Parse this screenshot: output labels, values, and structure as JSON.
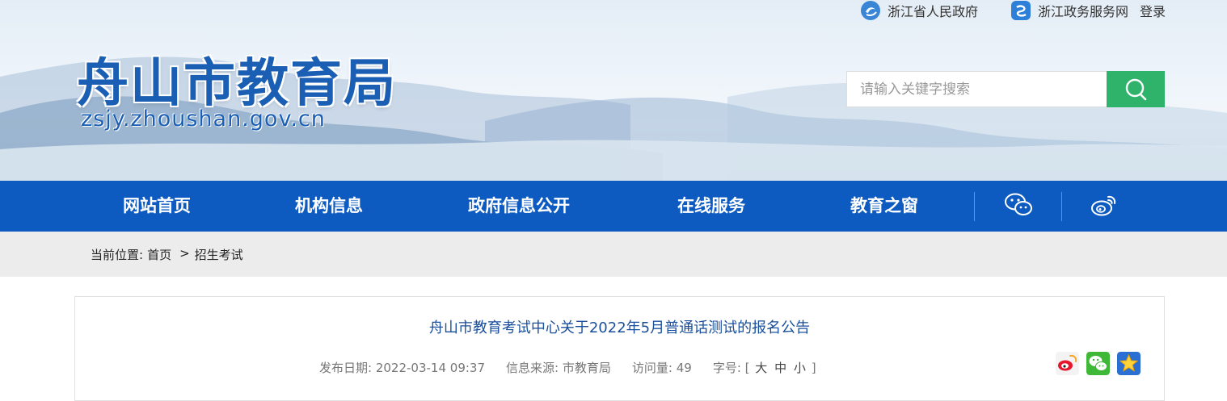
{
  "header": {
    "links": [
      {
        "label": "浙江省人民政府",
        "icon": "zhejiang-gov-icon"
      },
      {
        "label": "浙江政务服务网",
        "icon": "zhejiang-service-icon"
      }
    ],
    "login_label": "登录",
    "logo_cn": "舟山市教育局",
    "logo_en": "zsjy.zhoushan.gov.cn",
    "search_placeholder": "请输入关键字搜索"
  },
  "nav": {
    "items": [
      "网站首页",
      "机构信息",
      "政府信息公开",
      "在线服务",
      "教育之窗"
    ],
    "icons": [
      "wechat-icon",
      "weibo-icon"
    ]
  },
  "breadcrumb": {
    "prefix": "当前位置:",
    "home": "首页",
    "sep": ">",
    "current": "招生考试"
  },
  "article": {
    "title": "舟山市教育考试中心关于2022年5月普通话测试的报名公告",
    "date_label": "发布日期:",
    "date": "2022-03-14 09:37",
    "source_label": "信息来源:",
    "source": "市教育局",
    "views_label": "访问量:",
    "views": "49",
    "font_label": "字号:",
    "font_open": "[",
    "font_large": "大",
    "font_medium": "中",
    "font_small": "小",
    "font_close": "]",
    "share_icons": [
      "weibo-share-icon",
      "wechat-share-icon",
      "favorite-star-icon"
    ]
  },
  "colors": {
    "nav_bg": "#0d5bc0",
    "logo": "#1a5fb4",
    "search_btn": "#2fb36b",
    "title": "#1a4f9c"
  }
}
